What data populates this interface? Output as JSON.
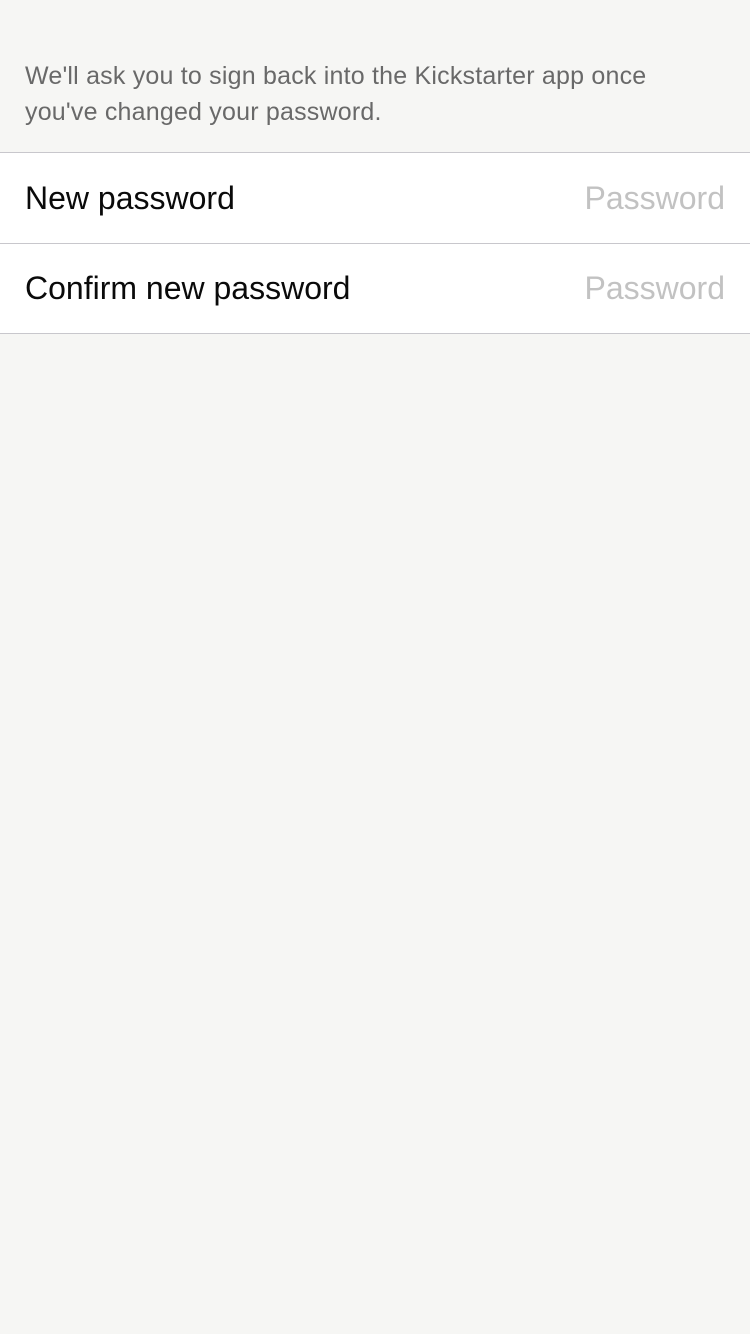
{
  "info": {
    "message": "We'll ask you to sign back into the Kickstarter app once you've changed your password."
  },
  "form": {
    "new_password": {
      "label": "New password",
      "value": "",
      "placeholder": "Password"
    },
    "confirm_password": {
      "label": "Confirm new password",
      "value": "",
      "placeholder": "Password"
    }
  },
  "colors": {
    "background": "#f6f6f4",
    "card": "#ffffff",
    "separator": "#c8c7cc",
    "info_text": "#696969",
    "label_text": "#0a0a0a",
    "placeholder_text": "#c2c2c2"
  }
}
